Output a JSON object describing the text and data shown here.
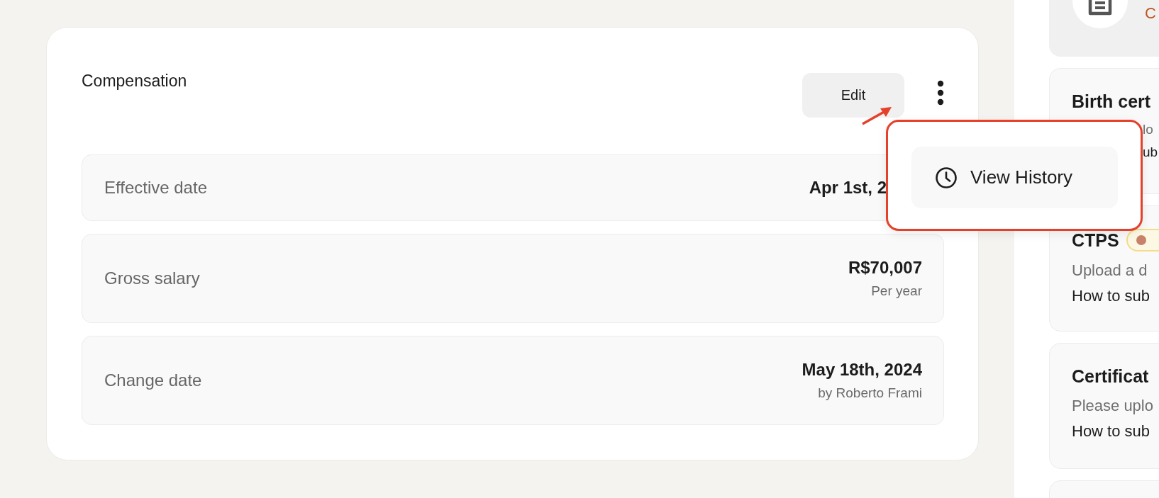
{
  "compensation": {
    "title": "Compensation",
    "edit_button": "Edit",
    "rows": [
      {
        "label": "Effective date",
        "value": "Apr 1st, 2"
      },
      {
        "label": "Gross salary",
        "value": "R$70,007",
        "note": "Per year"
      },
      {
        "label": "Change date",
        "value": "May 18th, 2024",
        "note": "by Roberto Frami"
      }
    ]
  },
  "menu": {
    "items": [
      {
        "label": "View History"
      }
    ]
  },
  "documents": [
    {
      "kind": "file",
      "status": "C"
    },
    {
      "kind": "doc",
      "title": "Birth cert",
      "lines": [
        "lo",
        "ub"
      ]
    },
    {
      "kind": "doc",
      "title": "CTPS",
      "badge": true,
      "lines": [
        "Upload a d",
        "How to sub"
      ]
    },
    {
      "kind": "doc",
      "title": "Certificat",
      "lines": [
        "Please uplo",
        "How to sub"
      ]
    },
    {
      "kind": "doc"
    }
  ]
}
